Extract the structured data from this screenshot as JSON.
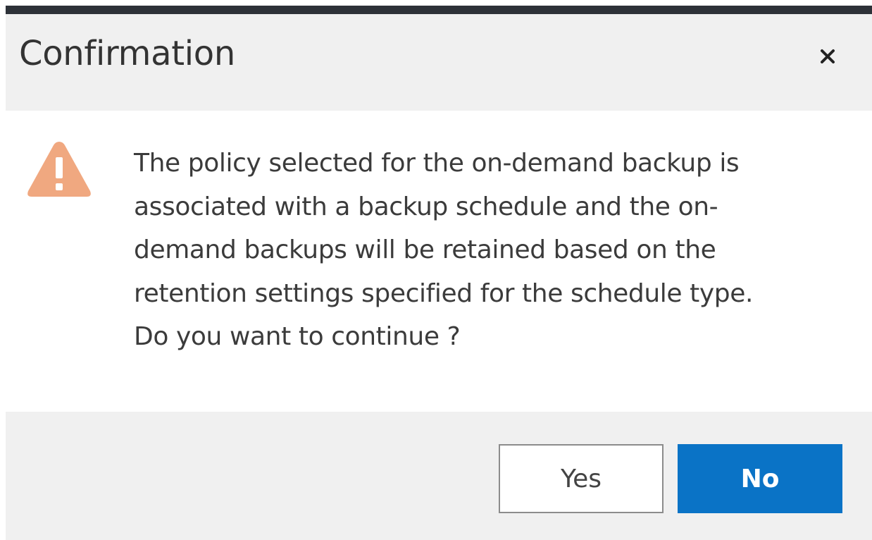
{
  "dialog": {
    "title": "Confirmation",
    "close_icon": "close-icon",
    "warning_icon": "warning-icon",
    "warning_color": "#f0a880",
    "message_lines": [
      "The policy selected for the on-demand backup is",
      "associated with a backup schedule and the on-",
      "demand backups will be retained based on the",
      "retention settings specified for the schedule type.",
      "Do you want to continue ?"
    ],
    "buttons": {
      "yes_label": "Yes",
      "no_label": "No"
    },
    "colors": {
      "primary": "#0a73c6",
      "header_bg": "#f0f0f0",
      "top_bar": "#2d3138"
    }
  }
}
